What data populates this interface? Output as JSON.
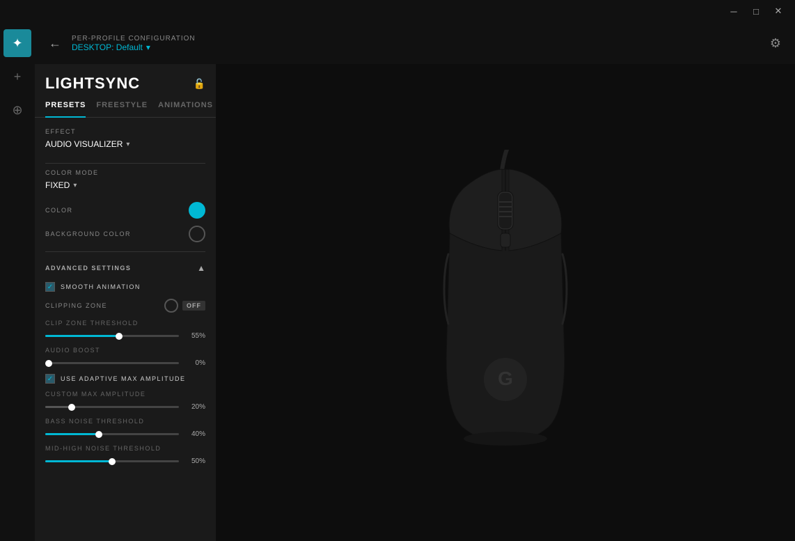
{
  "titlebar": {
    "minimize_label": "─",
    "maximize_label": "□",
    "close_label": "✕"
  },
  "header": {
    "subtitle": "PER-PROFILE CONFIGURATION",
    "profile": "DESKTOP: Default",
    "dropdown_arrow": "▾"
  },
  "panel": {
    "title": "LIGHTSYNC",
    "lock_icon": "🔒",
    "tabs": [
      {
        "label": "PRESETS",
        "active": true
      },
      {
        "label": "FREESTYLE",
        "active": false
      },
      {
        "label": "ANIMATIONS",
        "active": false
      }
    ],
    "effect": {
      "label": "EFFECT",
      "value": "AUDIO VISUALIZER",
      "arrow": "▾"
    },
    "color_mode": {
      "label": "COLOR MODE",
      "value": "FIXED",
      "arrow": "▾"
    },
    "color": {
      "label": "COLOR"
    },
    "background_color": {
      "label": "BACKGROUND COLOR"
    },
    "advanced": {
      "title": "ADVANCED SETTINGS",
      "collapse": "▲",
      "smooth_animation": {
        "label": "SMOOTH ANIMATION",
        "checked": true
      },
      "clipping_zone": {
        "label": "CLIPPING ZONE",
        "badge": "OFF"
      },
      "clip_zone_threshold": {
        "label": "CLIP ZONE THRESHOLD",
        "value": "55%",
        "percent": 55
      },
      "audio_boost": {
        "label": "AUDIO BOOST",
        "value": "0%",
        "percent": 0
      },
      "use_adaptive": {
        "label": "USE ADAPTIVE MAX AMPLITUDE",
        "checked": true
      },
      "custom_max_amplitude": {
        "label": "CUSTOM MAX AMPLITUDE",
        "value": "20%",
        "percent": 20
      },
      "bass_noise_threshold": {
        "label": "BASS NOISE THRESHOLD",
        "value": "40%",
        "percent": 40
      },
      "mid_high_noise_threshold": {
        "label": "MID-HIGH NOISE THRESHOLD",
        "value": "50%",
        "percent": 50
      }
    }
  },
  "icons": {
    "back": "←",
    "lightsync": "☀",
    "plus": "+",
    "crosshair": "⊕",
    "gear": "⚙"
  }
}
